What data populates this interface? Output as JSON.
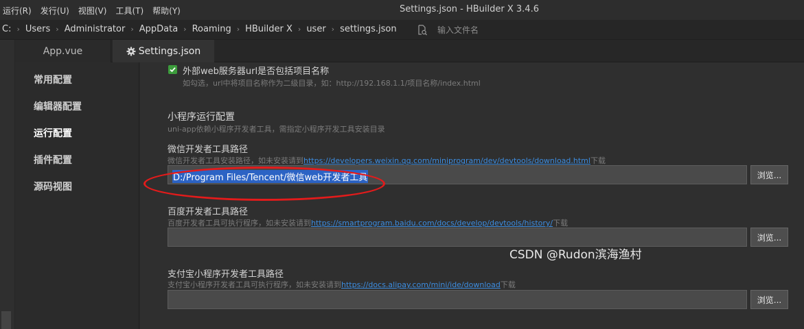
{
  "menu": [
    "运行(R)",
    "发行(U)",
    "视图(V)",
    "工具(T)",
    "帮助(Y)"
  ],
  "window_title": "Settings.json - HBuilder X 3.4.6",
  "breadcrumb": [
    "C:",
    "Users",
    "Administrator",
    "AppData",
    "Roaming",
    "HBuilder X",
    "user",
    "settings.json"
  ],
  "search": {
    "placeholder": "输入文件名"
  },
  "tabs": [
    {
      "label": "App.vue"
    },
    {
      "label": "Settings.json"
    }
  ],
  "nav": [
    "常用配置",
    "编辑器配置",
    "运行配置",
    "插件配置",
    "源码视图"
  ],
  "content": {
    "web_option": {
      "label": "外部web服务器url是否包括项目名称",
      "hint": "如勾选，url中将项目名称作为二级目录，如：http://192.168.1.1/项目名称/index.html"
    },
    "section_title": "小程序运行配置",
    "section_hint": "uni-app依赖小程序开发者工具，需指定小程序开发工具安装目录",
    "wechat": {
      "label": "微信开发者工具路径",
      "hint_pre": "微信开发者工具安装路径，如未安装请到",
      "link": "https://developers.weixin.qq.com/miniprogram/dev/devtools/download.html",
      "hint_post": "下载",
      "value": "D:/Program Files/Tencent/微信web开发者工具"
    },
    "baidu": {
      "label": "百度开发者工具路径",
      "hint_pre": "百度开发者工具可执行程序，如未安装请到",
      "link": "https://smartprogram.baidu.com/docs/develop/devtools/history/",
      "hint_post": "下载"
    },
    "alipay": {
      "label": "支付宝小程序开发者工具路径",
      "hint_pre": "支付宝小程序开发者工具可执行程序，如未安装请到",
      "link": "https://docs.alipay.com/mini/ide/download",
      "hint_post": "下载"
    },
    "browse_label": "浏览..."
  },
  "watermark": "CSDN @Rudon滨海渔村",
  "colors": {
    "accent": "#2c63c4",
    "link": "#3d8de0",
    "check": "#3c9c3c",
    "annotation": "#e31b1b"
  }
}
